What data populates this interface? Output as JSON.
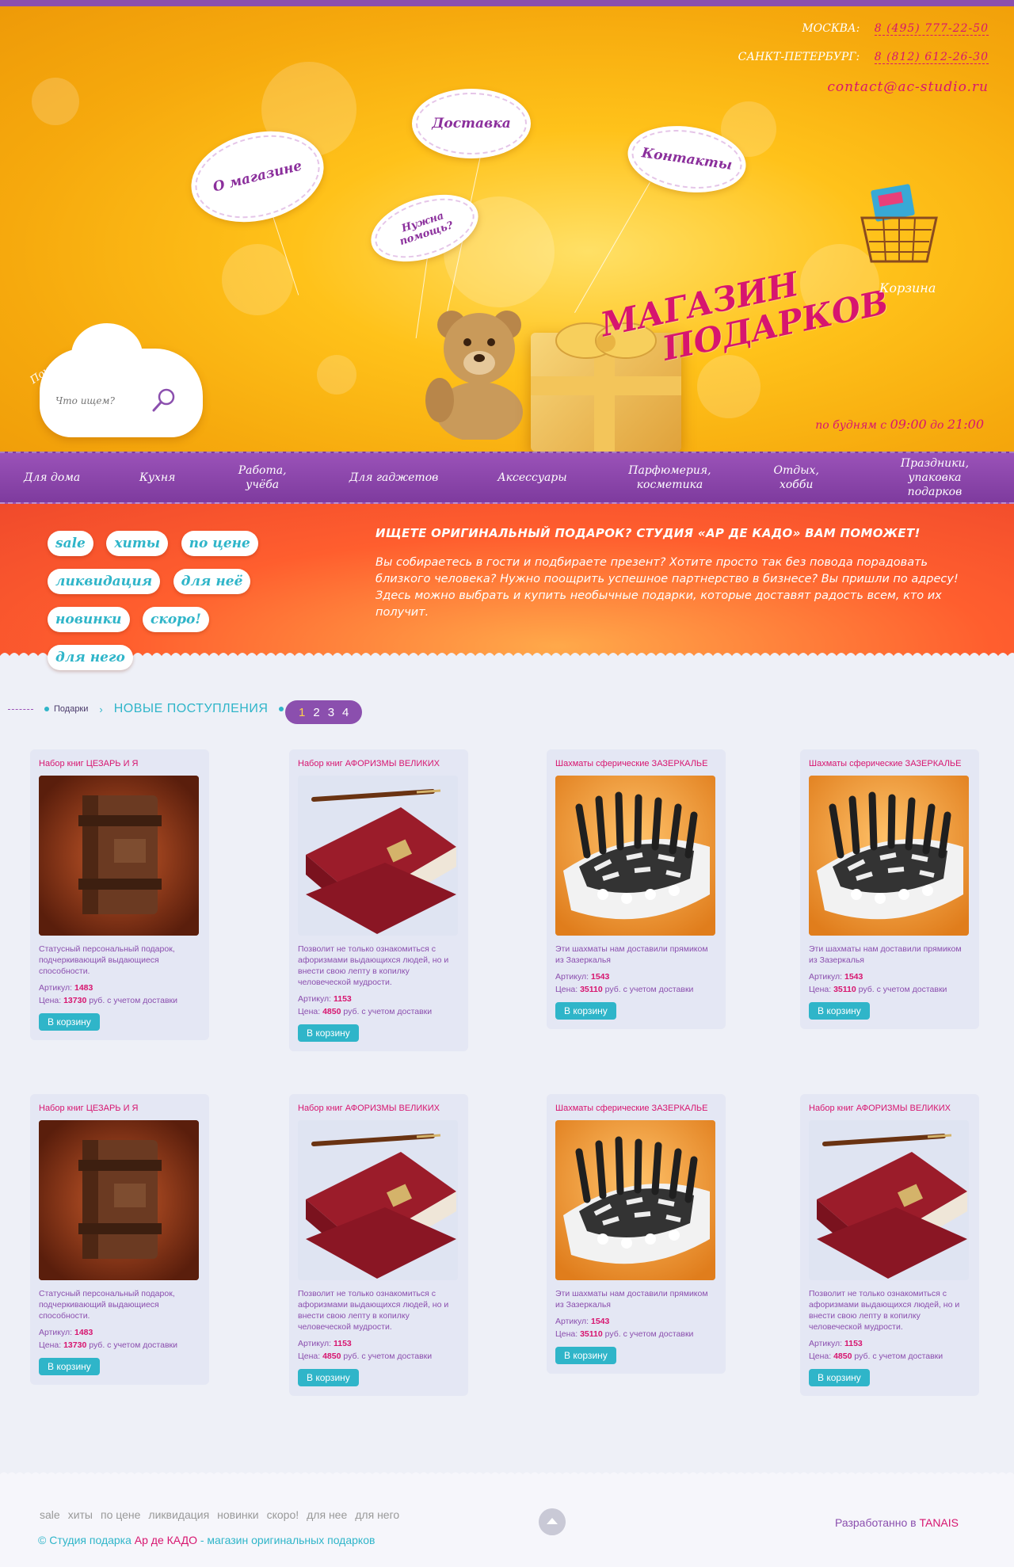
{
  "header": {
    "contacts": [
      {
        "city": "МОСКВА:",
        "phone": "8 (495) 777-22-50"
      },
      {
        "city": "САНКТ-ПЕТЕРБУРГ:",
        "phone": "8 (812) 612-26-30"
      }
    ],
    "email": "contact@ac-studio.ru",
    "clouds": {
      "about": "О магазине",
      "delivery": "Доставка",
      "help": "Нужна помощь?",
      "contacts": "Контакты"
    },
    "shop_title_line1": "МАГАЗИН",
    "shop_title_line2": "ПОДАРКОВ",
    "cart_label": "Корзина",
    "search_label": "Поиск",
    "search_placeholder": "Что ищем?",
    "hours_prefix": "по будням с",
    "hours_from": "09:00",
    "hours_mid": "до",
    "hours_to": "21:00"
  },
  "nav": [
    "Для дома",
    "Кухня",
    "Работа, учёба",
    "Для гаджетов",
    "Аксессуары",
    "Парфюмерия, косметика",
    "Отдых, хобби",
    "Праздники, упаковка подарков"
  ],
  "tags": [
    "sale",
    "хиты",
    "по цене",
    "ликвидация",
    "для неё",
    "новинки",
    "скоро!",
    "для него"
  ],
  "promo": {
    "title": "ИЩЕТЕ ОРИГИНАЛЬНЫЙ ПОДАРОК? СТУДИЯ «АР ДЕ КАДО» ВАМ ПОМОЖЕТ!",
    "text": "Вы собираетесь в гости и подбираете презент? Хотите просто так без повода порадовать близкого человека? Нужно поощрить успешное партнерство в бизнесе? Вы пришли по адресу! Здесь можно выбрать и купить необычные подарки, которые доставят радость всем, кто их получит."
  },
  "breadcrumb": {
    "home": "Подарки",
    "current": "НОВЫЕ ПОСТУПЛЕНИЯ"
  },
  "pager": [
    "1",
    "2",
    "3",
    "4"
  ],
  "labels": {
    "article": "Артикул:",
    "price": "Цена:",
    "currency_note": "руб. с учетом доставки",
    "to_cart": "В корзину"
  },
  "products": [
    {
      "name": "Набор книг ЦЕЗАРЬ И Я",
      "img": "book-brown",
      "desc": "Статусный персональный подарок, подчеркивающий выдающиеся способности.",
      "article": "1483",
      "price": "13730"
    },
    {
      "name": "Набор книг АФОРИЗМЫ ВЕЛИКИХ",
      "img": "book-red",
      "desc": "Позволит не только ознакомиться с афоризмами выдающихся людей, но и внести свою лепту в копилку человеческой мудрости.",
      "article": "1153",
      "price": "4850"
    },
    {
      "name": "Шахматы сферические ЗАЗЕРКАЛЬЕ",
      "img": "chess",
      "desc": "Эти шахматы нам доставили прямиком из Зазеркалья",
      "article": "1543",
      "price": "35110"
    },
    {
      "name": "Шахматы сферические ЗАЗЕРКАЛЬЕ",
      "img": "chess",
      "desc": "Эти шахматы нам доставили прямиком из Зазеркалья",
      "article": "1543",
      "price": "35110"
    },
    {
      "name": "Набор книг ЦЕЗАРЬ И Я",
      "img": "book-brown",
      "desc": "Статусный персональный подарок, подчеркивающий выдающиеся способности.",
      "article": "1483",
      "price": "13730"
    },
    {
      "name": "Набор книг АФОРИЗМЫ ВЕЛИКИХ",
      "img": "book-red",
      "desc": "Позволит не только ознакомиться с афоризмами выдающихся людей, но и внести свою лепту в копилку человеческой мудрости.",
      "article": "1153",
      "price": "4850"
    },
    {
      "name": "Шахматы сферические ЗАЗЕРКАЛЬЕ",
      "img": "chess",
      "desc": "Эти шахматы нам доставили прямиком из Зазеркалья",
      "article": "1543",
      "price": "35110"
    },
    {
      "name": "Набор книг АФОРИЗМЫ ВЕЛИКИХ",
      "img": "book-red",
      "desc": "Позволит не только ознакомиться с афоризмами выдающихся людей, но и внести свою лепту в копилку человеческой мудрости.",
      "article": "1153",
      "price": "4850"
    }
  ],
  "footer": {
    "links": [
      "sale",
      "хиты",
      "по цене",
      "ликвидация",
      "новинки",
      "скоро!",
      "для нее",
      "для него"
    ],
    "copy_prefix": "© Студия подарка",
    "copy_brand": "Ар де КАДО",
    "copy_suffix": "- магазин оригинальных подарков",
    "dev_prefix": "Разработанно в",
    "dev_brand": "TANAIS"
  },
  "colors": {
    "accent": "#8b4fae",
    "pink": "#d7156f",
    "teal": "#2fb5c9",
    "orange": "#ff5e2e",
    "yellow": "#ffc21a"
  }
}
